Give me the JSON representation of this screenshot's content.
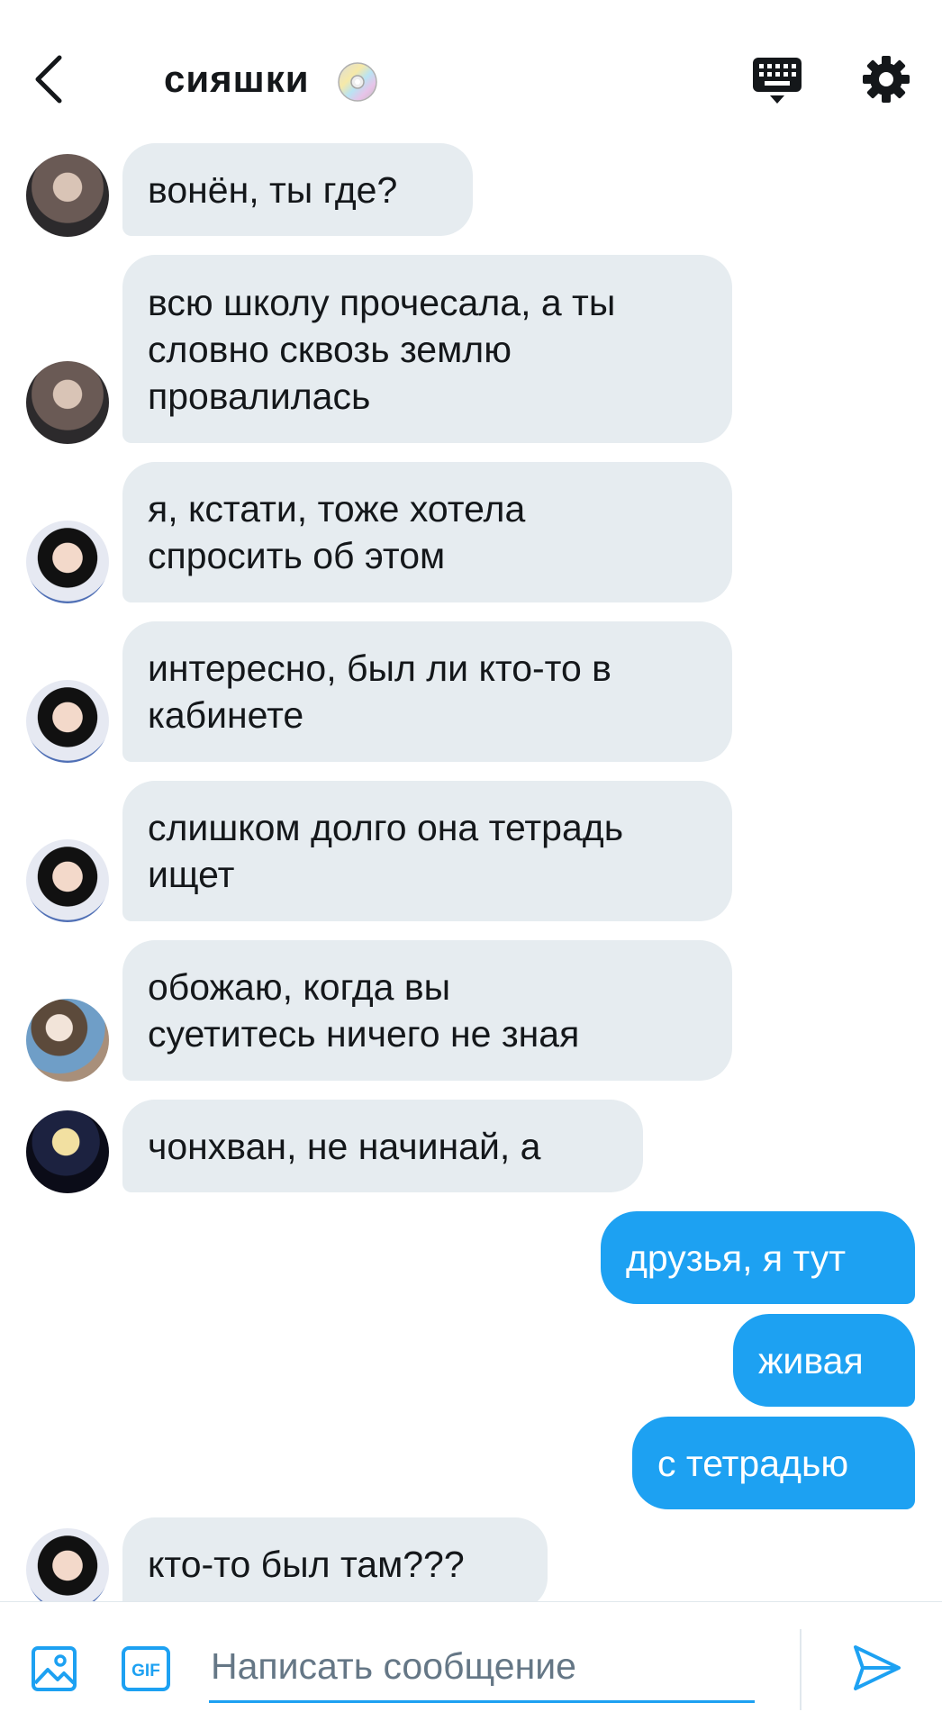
{
  "header": {
    "title": "сияшки",
    "title_emoji": "📀"
  },
  "messages": [
    {
      "text": "вонён, ты где?"
    },
    {
      "text": "всю школу прочесала, а ты\nсловно сквозь землю\nпровалилась"
    },
    {
      "text": "я, кстати, тоже хотела\nспросить об этом"
    },
    {
      "text": "интересно, был ли кто-то в\nкабинете"
    },
    {
      "text": "слишком долго она тетрадь\nищет"
    },
    {
      "text": "обожаю, когда вы\nсуетитесь ничего не зная"
    },
    {
      "text": "чонхван, не начинай, а"
    },
    {
      "text": "друзья, я тут"
    },
    {
      "text": "живая"
    },
    {
      "text": "с тетрадью"
    },
    {
      "text": "кто-то был там???"
    }
  ],
  "composer": {
    "placeholder": "Написать сообщение"
  },
  "colors": {
    "accent": "#1da1f2",
    "incoming_bubble": "#e6ecf0",
    "text": "#14171a",
    "placeholder": "#657786"
  }
}
